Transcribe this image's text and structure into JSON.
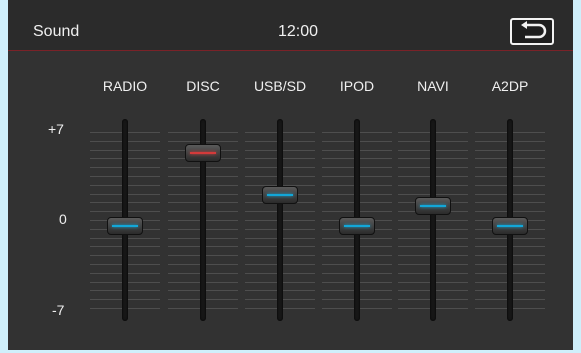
{
  "header": {
    "title": "Sound",
    "time": "12:00",
    "back_icon": "return-arrow-icon"
  },
  "scale": {
    "max_label": "+7",
    "mid_label": "0",
    "min_label": "-7",
    "min": -7,
    "max": 7
  },
  "channels": [
    {
      "label": "RADIO",
      "level": -0.5,
      "color": "#12a7d8"
    },
    {
      "label": "DISC",
      "level": 5.3,
      "color": "#d43a3a"
    },
    {
      "label": "USB/SD",
      "level": 2.0,
      "color": "#12a7d8"
    },
    {
      "label": "IPOD",
      "level": -0.5,
      "color": "#12a7d8"
    },
    {
      "label": "NAVI",
      "level": 1.1,
      "color": "#12a7d8"
    },
    {
      "label": "A2DP",
      "level": -0.5,
      "color": "#12a7d8"
    }
  ],
  "colors": {
    "header_divider": "#7a2228",
    "active_knob": "#d43a3a",
    "knob_indicator": "#12a7d8"
  }
}
